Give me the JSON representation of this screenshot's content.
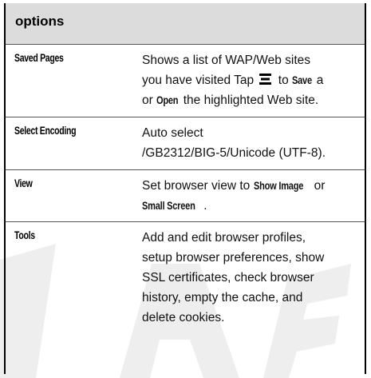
{
  "table": {
    "header": "options",
    "rows": [
      {
        "term": "Saved Pages",
        "line1": "Shows a list of WAP/Web sites",
        "line2_a": "you have visited Tap",
        "line2_b": "to",
        "line2_kw": "Save",
        "line2_c": "a",
        "line3_a": "or",
        "line3_kw": "Open",
        "line3_b": "the highlighted Web site."
      },
      {
        "term": "Select Encoding",
        "line1": "Auto select",
        "line2": "/GB2312/BIG-5/Unicode (UTF-8)."
      },
      {
        "term": "View",
        "line1_a": "Set browser view to",
        "line1_kw": "Show Image",
        "line1_b": "or",
        "line2_kw": "Small Screen",
        "line2_b": "."
      },
      {
        "term": "Tools",
        "lines": [
          "Add and edit browser profiles,",
          "setup browser preferences, show",
          "SSL certificates, check browser",
          "history, empty the cache, and",
          "delete cookies."
        ]
      }
    ]
  },
  "icons": {
    "menu": "menu-icon",
    "watermark": "draft-watermark"
  }
}
